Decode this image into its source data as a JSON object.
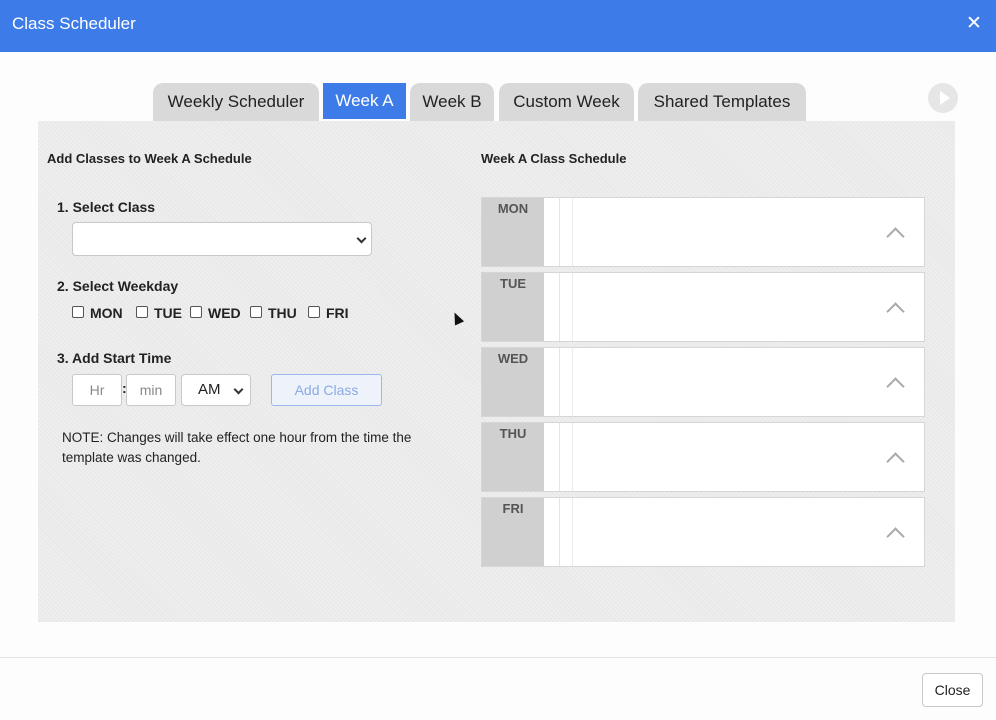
{
  "window": {
    "title": "Class Scheduler"
  },
  "tabs": [
    {
      "label": "Weekly Scheduler",
      "active": false
    },
    {
      "label": "Week A",
      "active": true
    },
    {
      "label": "Week B",
      "active": false
    },
    {
      "label": "Custom Week",
      "active": false
    },
    {
      "label": "Shared Templates",
      "active": false
    }
  ],
  "left": {
    "title": "Add Classes to Week A Schedule",
    "step1": "1. Select Class",
    "step2": "2. Select Weekday",
    "weekdays": [
      "MON",
      "TUE",
      "WED",
      "THU",
      "FRI"
    ],
    "step3": "3. Add Start Time",
    "hour_placeholder": "Hr",
    "min_placeholder": "min",
    "colon": ":",
    "ampm_value": "AM",
    "add_button": "Add Class",
    "note": "NOTE: Changes will take effect one hour from the time the template was changed."
  },
  "right": {
    "title": "Week A Class Schedule",
    "days": [
      "MON",
      "TUE",
      "WED",
      "THU",
      "FRI"
    ]
  },
  "footer": {
    "close_label": "Close"
  },
  "colors": {
    "accent": "#3d7be8",
    "panel": "#e9e9e9",
    "tab_inactive": "#d9d9d9"
  },
  "icons": {
    "close": "close-icon",
    "play": "play-icon",
    "chevron": "chevron-down-icon",
    "caret": "chevron-up-icon"
  }
}
